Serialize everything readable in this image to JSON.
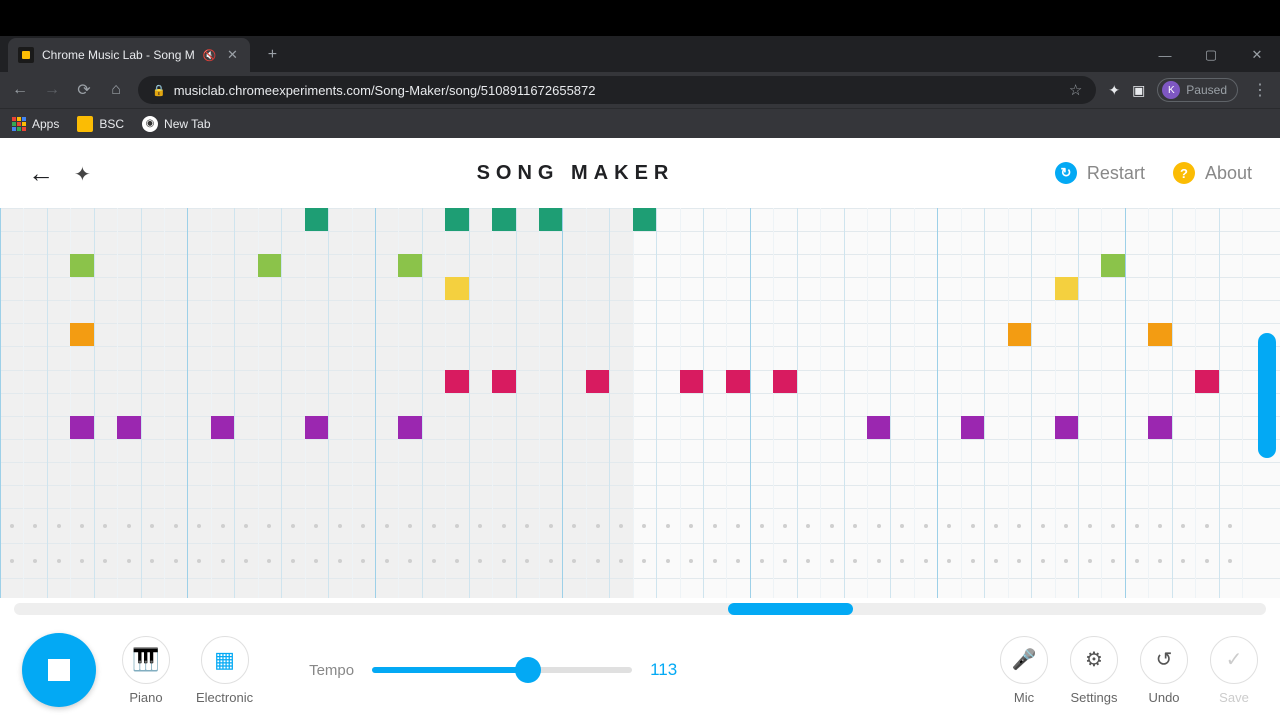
{
  "browser": {
    "tab_title": "Chrome Music Lab - Song M",
    "tab_muted": true,
    "url": "musiclab.chromeexperiments.com/Song-Maker/song/5108911672655872",
    "profile_initial": "K",
    "profile_state": "Paused",
    "bookmarks": [
      {
        "label": "Apps",
        "kind": "apps"
      },
      {
        "label": "BSC",
        "kind": "folder"
      },
      {
        "label": "New Tab",
        "kind": "globe"
      }
    ]
  },
  "header": {
    "title": "SONG MAKER",
    "restart": "Restart",
    "about": "About"
  },
  "grid": {
    "playhead_col": 27,
    "cols": 53,
    "melody_rows": 13,
    "perc_rows": 2,
    "bar_every": 8,
    "colors": {
      "teal": "#1e9e74",
      "lime": "#8bc34a",
      "yellow": "#f4d03f",
      "orange": "#f39c12",
      "pink": "#d81b60",
      "purple": "#9b27b0"
    },
    "notes": [
      {
        "row": 0,
        "col": 13,
        "c": "teal"
      },
      {
        "row": 0,
        "col": 19,
        "c": "teal"
      },
      {
        "row": 0,
        "col": 21,
        "c": "teal"
      },
      {
        "row": 0,
        "col": 23,
        "c": "teal"
      },
      {
        "row": 0,
        "col": 27,
        "c": "teal"
      },
      {
        "row": 2,
        "col": 3,
        "c": "lime"
      },
      {
        "row": 2,
        "col": 11,
        "c": "lime"
      },
      {
        "row": 2,
        "col": 17,
        "c": "lime"
      },
      {
        "row": 2,
        "col": 47,
        "c": "lime"
      },
      {
        "row": 3,
        "col": 19,
        "c": "yellow"
      },
      {
        "row": 3,
        "col": 45,
        "c": "yellow"
      },
      {
        "row": 5,
        "col": 3,
        "c": "orange"
      },
      {
        "row": 5,
        "col": 43,
        "c": "orange"
      },
      {
        "row": 5,
        "col": 49,
        "c": "orange"
      },
      {
        "row": 7,
        "col": 19,
        "c": "pink"
      },
      {
        "row": 7,
        "col": 21,
        "c": "pink"
      },
      {
        "row": 7,
        "col": 25,
        "c": "pink"
      },
      {
        "row": 7,
        "col": 29,
        "c": "pink"
      },
      {
        "row": 7,
        "col": 31,
        "c": "pink"
      },
      {
        "row": 7,
        "col": 33,
        "c": "pink"
      },
      {
        "row": 7,
        "col": 51,
        "c": "pink"
      },
      {
        "row": 9,
        "col": 3,
        "c": "purple"
      },
      {
        "row": 9,
        "col": 5,
        "c": "purple"
      },
      {
        "row": 9,
        "col": 9,
        "c": "purple"
      },
      {
        "row": 9,
        "col": 13,
        "c": "purple"
      },
      {
        "row": 9,
        "col": 17,
        "c": "purple"
      },
      {
        "row": 9,
        "col": 37,
        "c": "purple"
      },
      {
        "row": 9,
        "col": 41,
        "c": "purple"
      },
      {
        "row": 9,
        "col": 45,
        "c": "purple"
      },
      {
        "row": 9,
        "col": 49,
        "c": "purple"
      }
    ]
  },
  "hscroll": {
    "pos": 57,
    "width": 10
  },
  "vscroll": {
    "top_pct": 32,
    "height_pct": 32
  },
  "controls": {
    "playing": true,
    "instrument1": "Piano",
    "instrument2": "Electronic",
    "tempo_label": "Tempo",
    "tempo_value": "113",
    "tempo_pct": 60,
    "mic": "Mic",
    "settings": "Settings",
    "undo": "Undo",
    "save": "Save"
  }
}
